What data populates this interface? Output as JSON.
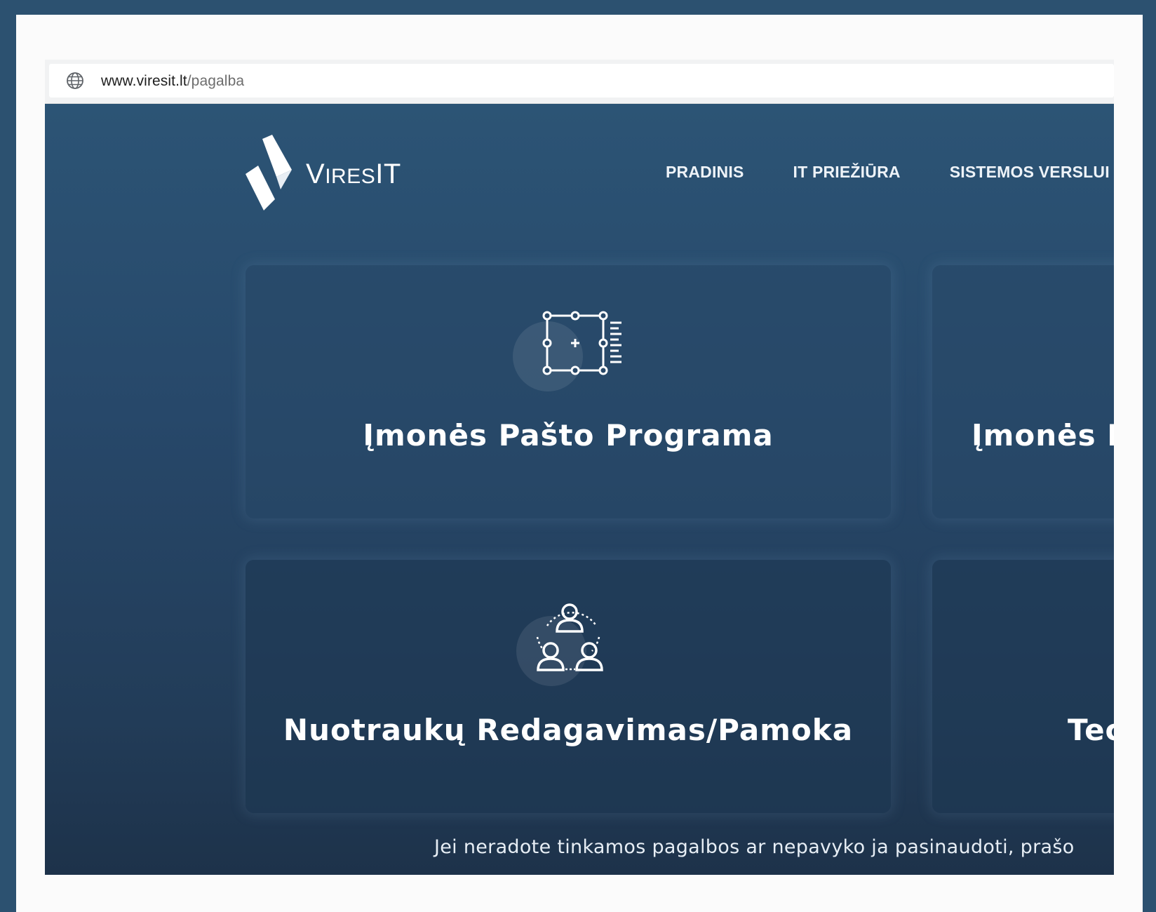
{
  "browser": {
    "url_domain": "www.viresit.lt",
    "url_path": "/pagalba",
    "globe_icon": "globe-icon"
  },
  "site": {
    "logo_text_first": "V",
    "logo_text_rest": "IRES",
    "logo_text_end": "IT",
    "nav": [
      {
        "label": "PRADINIS"
      },
      {
        "label": "IT PRIEŽIŪRA"
      },
      {
        "label": "SISTEMOS VERSLUI"
      }
    ],
    "cards": [
      {
        "title": "Įmonės Pašto Programa",
        "icon": "layout-editor-icon"
      },
      {
        "title": "Įmonės P",
        "icon": ""
      },
      {
        "title": "Nuotraukų Redagavimas/Pamoka",
        "icon": "team-network-icon"
      },
      {
        "title": "Tec",
        "icon": ""
      }
    ],
    "footer_text": "Jei neradote tinkamos pagalbos ar nepavyko ja pasinaudoti, prašo"
  },
  "colors": {
    "frame_border": "#2c5170",
    "site_top": "#2c5475",
    "site_bottom": "#1d324a",
    "text": "#ffffff"
  }
}
